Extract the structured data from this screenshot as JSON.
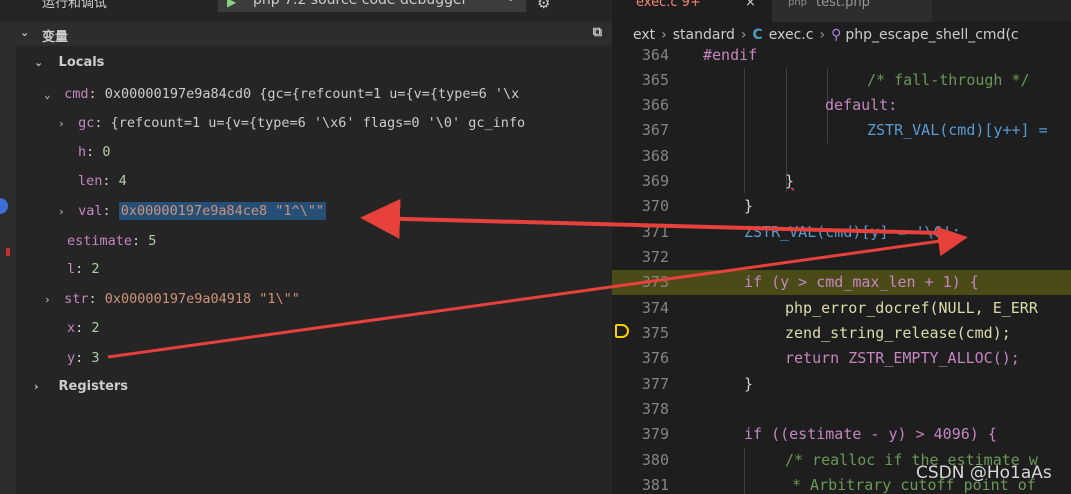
{
  "topbar": {
    "run_label": "运行和调试",
    "debug_config": "php 7.2 source code debugger",
    "play_glyph": "▶",
    "chevron_glyph": "⌄",
    "gear_glyph": "⚙"
  },
  "variables": {
    "header": "变量",
    "scope": "Locals",
    "registers": "Registers",
    "items": [
      {
        "name": "cmd",
        "value": "0x00000197e9a84cd0 {gc={refcount=1 u={v={type=6 '\\x"
      },
      {
        "name": "gc",
        "value": "{refcount=1 u={v={type=6 '\\x6' flags=0 '\\0' gc_info"
      },
      {
        "name": "h",
        "value": "0"
      },
      {
        "name": "len",
        "value": "4"
      },
      {
        "name": "val",
        "value": "0x00000197e9a84ce8 \"1^\\\"\""
      },
      {
        "name": "estimate",
        "value": "5"
      },
      {
        "name": "l",
        "value": "2"
      },
      {
        "name": "str",
        "value": "0x00000197e9a04918 \"1\\\"\""
      },
      {
        "name": "x",
        "value": "2"
      },
      {
        "name": "y",
        "value": "3"
      }
    ]
  },
  "editor": {
    "tabs": [
      "exec.c 9+",
      "test.php"
    ],
    "tab_close": "×",
    "breadcrumb": {
      "folder1": "ext",
      "folder2": "standard",
      "file": "exec.c",
      "symbol": "php_escape_shell_cmd(c"
    },
    "lines": [
      {
        "n": "364",
        "t": "#endif"
      },
      {
        "n": "365",
        "t": "/* fall-through */"
      },
      {
        "n": "366",
        "t": "default:"
      },
      {
        "n": "367",
        "t": "ZSTR_VAL(cmd)[y++] ="
      },
      {
        "n": "368",
        "t": ""
      },
      {
        "n": "369",
        "t": "}"
      },
      {
        "n": "370",
        "t": "}"
      },
      {
        "n": "371",
        "t": "ZSTR_VAL(cmd)[y] = '\\0';"
      },
      {
        "n": "372",
        "t": ""
      },
      {
        "n": "373",
        "t": "if (y > cmd_max_len + 1) {"
      },
      {
        "n": "374",
        "t": "php_error_docref(NULL, E_ERR"
      },
      {
        "n": "375",
        "t": "zend_string_release(cmd);"
      },
      {
        "n": "376",
        "t": "return ZSTR_EMPTY_ALLOC();"
      },
      {
        "n": "377",
        "t": "}"
      },
      {
        "n": "378",
        "t": ""
      },
      {
        "n": "379",
        "t": "if ((estimate - y) > 4096) {"
      },
      {
        "n": "380",
        "t": "/* realloc if the estimate w"
      },
      {
        "n": "381",
        "t": "* Arbitrary cutoff point of"
      }
    ]
  },
  "watermark": "CSDN @Ho1aAs",
  "colors": {
    "annotation": "#e8403a",
    "highlight": "#4b4b18",
    "selection": "#264f78"
  }
}
